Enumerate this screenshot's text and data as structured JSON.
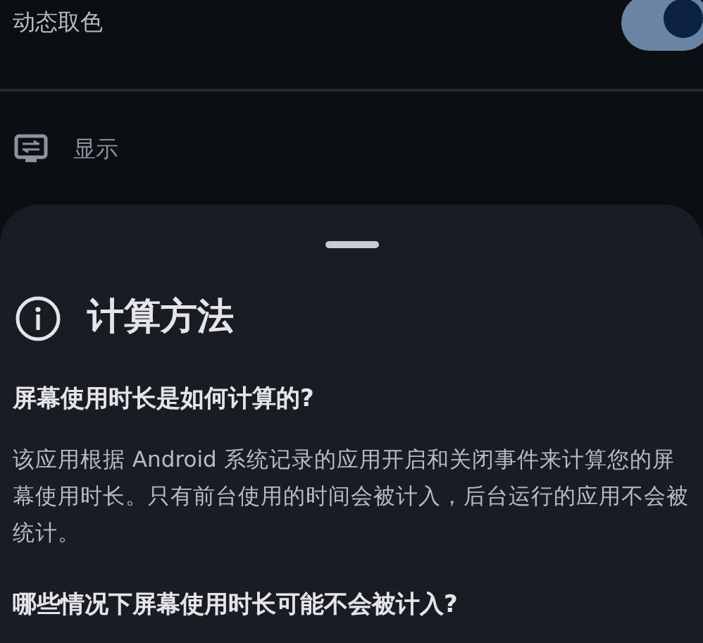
{
  "settings": [
    {
      "kind": "toggle",
      "label": "动态取色",
      "on": true
    },
    {
      "kind": "category",
      "label": "显示"
    }
  ],
  "sheet": {
    "title": "计算方法",
    "sections": [
      {
        "question": "屏幕使用时长是如何计算的?",
        "answer": "该应用根据 Android 系统记录的应用开启和关闭事件来计算您的屏幕使用时长。只有前台使用的时间会被计入，后台运行的应用不会被统计。"
      },
      {
        "question": "哪些情况下屏幕使用时长可能不会被计入?"
      }
    ]
  }
}
